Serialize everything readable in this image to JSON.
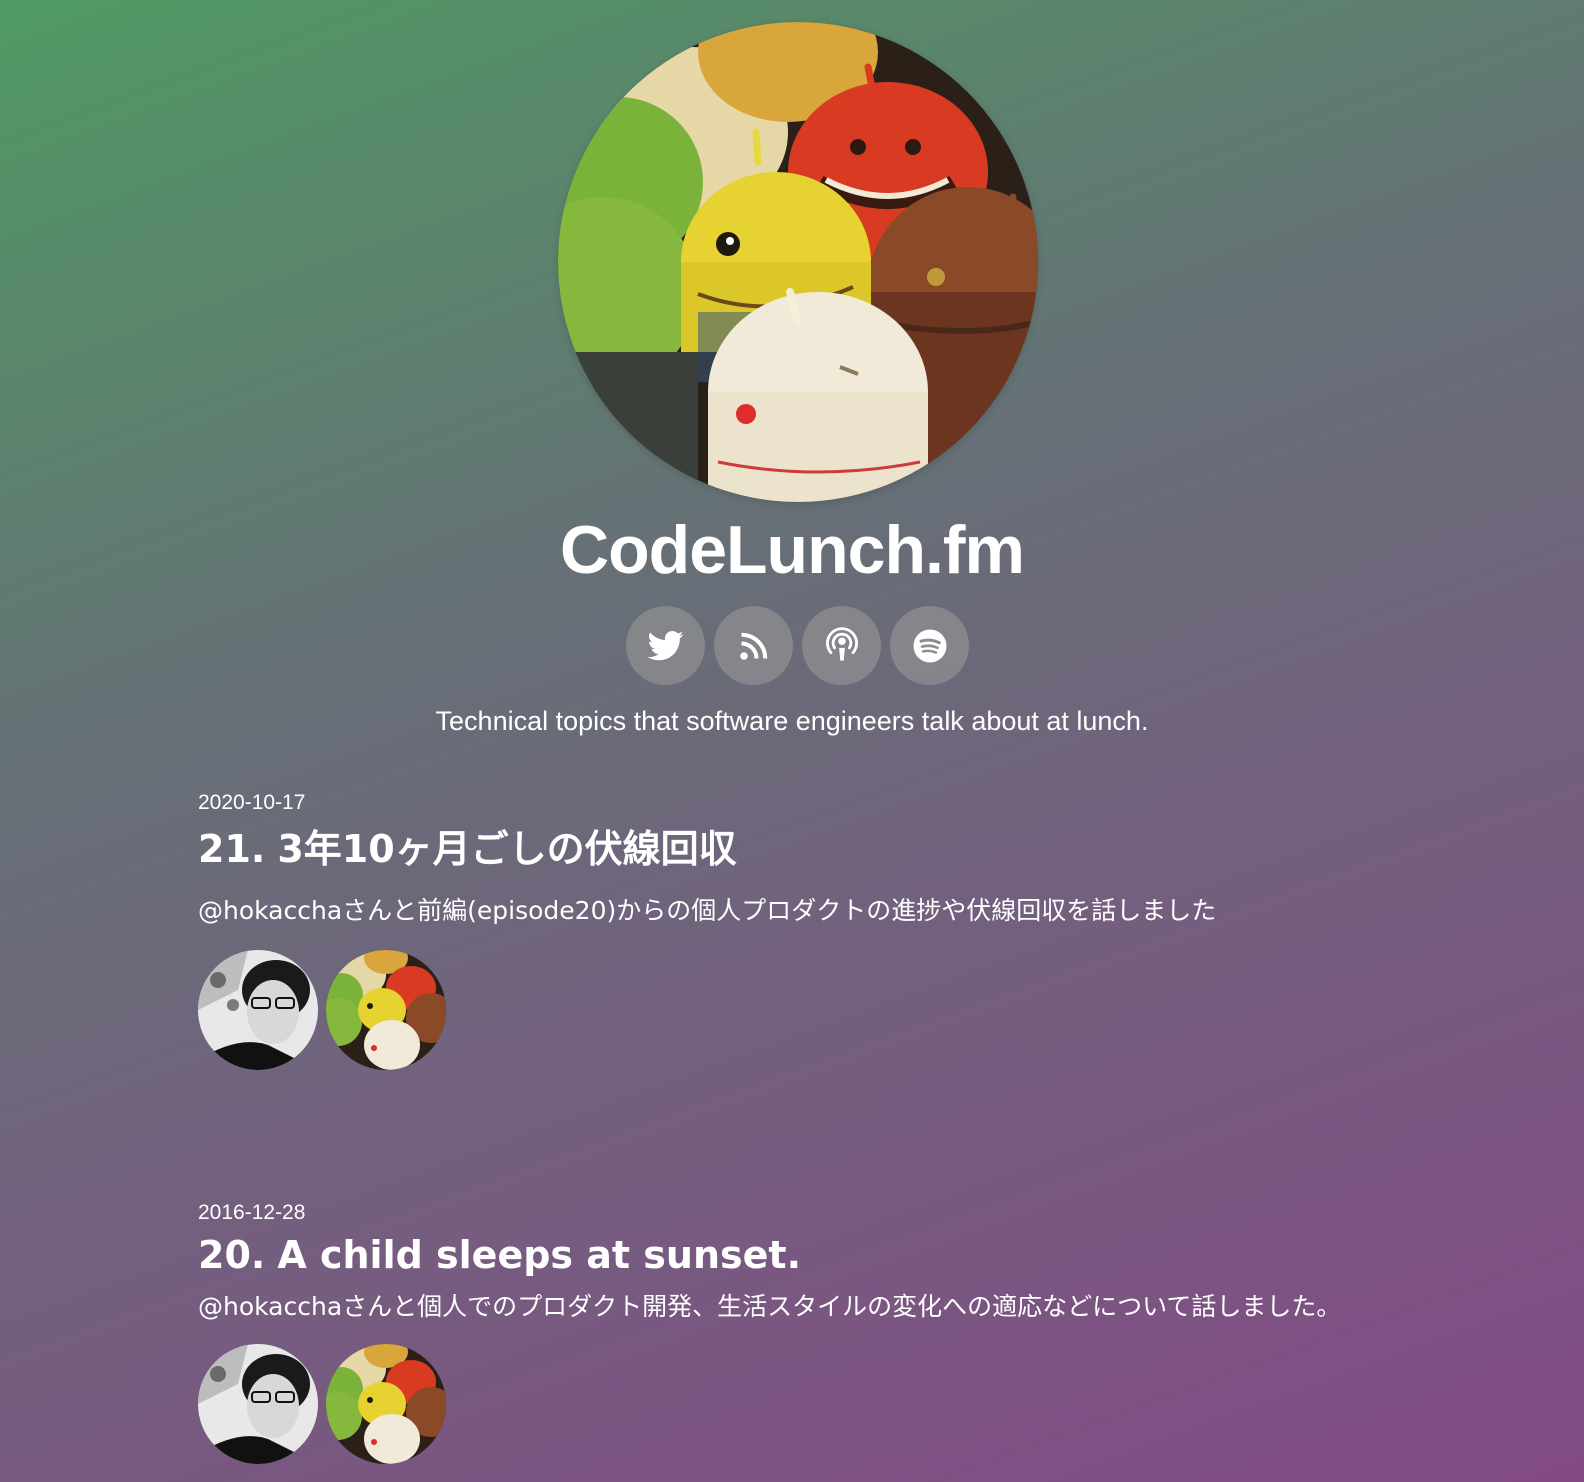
{
  "site": {
    "title": "CodeLunch.fm",
    "tagline": "Technical topics that software engineers talk about at lunch.",
    "logo_alt": "CodeLunch.fm logo - android figures"
  },
  "social": [
    {
      "name": "twitter",
      "icon": "twitter-bird-icon"
    },
    {
      "name": "rss",
      "icon": "rss-feed-icon"
    },
    {
      "name": "apple-podcasts",
      "icon": "podcast-icon"
    },
    {
      "name": "spotify",
      "icon": "spotify-icon"
    }
  ],
  "episodes": [
    {
      "date": "2020-10-17",
      "number": "21.",
      "title": "3年10ヶ月ごしの伏線回収",
      "description": "@hokacchaさんと前編(episode20)からの個人プロダクトの進捗や伏線回収を話しました",
      "guests": [
        "hokaccha",
        "codelunch-host"
      ]
    },
    {
      "date": "2016-12-28",
      "number": "20.",
      "title": "A child sleeps at sunset.",
      "description": "@hokacchaさんと個人でのプロダクト開発、生活スタイルの変化への適応などについて話しました。",
      "guests": [
        "hokaccha",
        "codelunch-host"
      ]
    }
  ],
  "colors": {
    "gradient_start": "#4f9a63",
    "gradient_end": "#824a85",
    "icon_button_bg": "#969696"
  }
}
